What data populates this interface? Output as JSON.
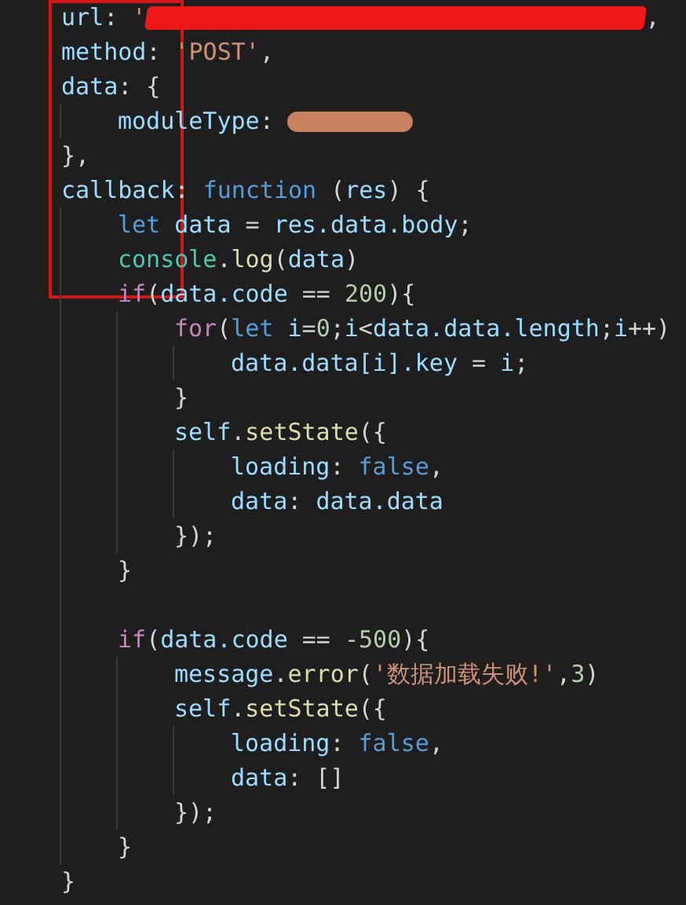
{
  "editor": {
    "lines": [
      {
        "tokens": [
          {
            "kind": "prop",
            "text": "url"
          },
          {
            "kind": "punct",
            "text": ": "
          },
          {
            "kind": "string",
            "text": "'"
          },
          {
            "kind": "scribble"
          },
          {
            "kind": "punct",
            "text": ","
          }
        ]
      },
      {
        "tokens": [
          {
            "kind": "prop",
            "text": "method"
          },
          {
            "kind": "punct",
            "text": ": "
          },
          {
            "kind": "string",
            "text": "'POST'"
          },
          {
            "kind": "punct",
            "text": ","
          }
        ]
      },
      {
        "tokens": [
          {
            "kind": "prop",
            "text": "data"
          },
          {
            "kind": "punct",
            "text": ": {"
          }
        ],
        "children": [
          {
            "tokens": [
              {
                "kind": "prop",
                "text": "moduleType"
              },
              {
                "kind": "punct",
                "text": ": "
              },
              {
                "kind": "smudge"
              }
            ]
          }
        ]
      },
      {
        "tokens": [
          {
            "kind": "punct",
            "text": "},"
          }
        ]
      },
      {
        "tokens": [
          {
            "kind": "prop",
            "text": "callback"
          },
          {
            "kind": "punct",
            "text": ": "
          },
          {
            "kind": "keyword",
            "text": "function"
          },
          {
            "kind": "punct",
            "text": " ("
          },
          {
            "kind": "prop",
            "text": "res"
          },
          {
            "kind": "punct",
            "text": ") {"
          }
        ],
        "children": [
          {
            "tokens": [
              {
                "kind": "keyword",
                "text": "let"
              },
              {
                "kind": "prop",
                "text": " data "
              },
              {
                "kind": "punct",
                "text": "= "
              },
              {
                "kind": "prop",
                "text": "res.data.body"
              },
              {
                "kind": "punct",
                "text": ";"
              }
            ]
          },
          {
            "tokens": [
              {
                "kind": "type",
                "text": "console"
              },
              {
                "kind": "punct",
                "text": "."
              },
              {
                "kind": "func",
                "text": "log"
              },
              {
                "kind": "punct",
                "text": "("
              },
              {
                "kind": "prop",
                "text": "data"
              },
              {
                "kind": "punct",
                "text": ")"
              }
            ]
          },
          {
            "tokens": [
              {
                "kind": "control",
                "text": "if"
              },
              {
                "kind": "punct",
                "text": "("
              },
              {
                "kind": "prop",
                "text": "data.code"
              },
              {
                "kind": "punct",
                "text": " == "
              },
              {
                "kind": "number",
                "text": "200"
              },
              {
                "kind": "punct",
                "text": "){"
              }
            ],
            "children": [
              {
                "tokens": [
                  {
                    "kind": "control",
                    "text": "for"
                  },
                  {
                    "kind": "punct",
                    "text": "("
                  },
                  {
                    "kind": "keyword",
                    "text": "let"
                  },
                  {
                    "kind": "prop",
                    "text": " i"
                  },
                  {
                    "kind": "punct",
                    "text": "="
                  },
                  {
                    "kind": "number",
                    "text": "0"
                  },
                  {
                    "kind": "punct",
                    "text": ";"
                  },
                  {
                    "kind": "prop",
                    "text": "i"
                  },
                  {
                    "kind": "punct",
                    "text": "<"
                  },
                  {
                    "kind": "prop",
                    "text": "data.data.length"
                  },
                  {
                    "kind": "punct",
                    "text": ";"
                  },
                  {
                    "kind": "prop",
                    "text": "i"
                  },
                  {
                    "kind": "punct",
                    "text": "++)"
                  }
                ],
                "children": [
                  {
                    "tokens": [
                      {
                        "kind": "prop",
                        "text": "data.data[i].key"
                      },
                      {
                        "kind": "punct",
                        "text": " = "
                      },
                      {
                        "kind": "prop",
                        "text": "i"
                      },
                      {
                        "kind": "punct",
                        "text": ";"
                      }
                    ]
                  }
                ]
              },
              {
                "tokens": [
                  {
                    "kind": "punct",
                    "text": "}"
                  }
                ]
              },
              {
                "tokens": [
                  {
                    "kind": "prop",
                    "text": "self"
                  },
                  {
                    "kind": "punct",
                    "text": "."
                  },
                  {
                    "kind": "func",
                    "text": "setState"
                  },
                  {
                    "kind": "punct",
                    "text": "({"
                  }
                ],
                "children": [
                  {
                    "tokens": [
                      {
                        "kind": "prop",
                        "text": "loading"
                      },
                      {
                        "kind": "punct",
                        "text": ": "
                      },
                      {
                        "kind": "keyword",
                        "text": "false"
                      },
                      {
                        "kind": "punct",
                        "text": ","
                      }
                    ]
                  },
                  {
                    "tokens": [
                      {
                        "kind": "prop",
                        "text": "data"
                      },
                      {
                        "kind": "punct",
                        "text": ": "
                      },
                      {
                        "kind": "prop",
                        "text": "data.data"
                      }
                    ]
                  }
                ]
              },
              {
                "tokens": [
                  {
                    "kind": "punct",
                    "text": "});"
                  }
                ]
              }
            ]
          },
          {
            "tokens": [
              {
                "kind": "punct",
                "text": "}"
              }
            ]
          },
          {
            "blank_line_before": true,
            "tokens": [
              {
                "kind": "control",
                "text": "if"
              },
              {
                "kind": "punct",
                "text": "("
              },
              {
                "kind": "prop",
                "text": "data.code"
              },
              {
                "kind": "punct",
                "text": " == "
              },
              {
                "kind": "number",
                "text": "-500"
              },
              {
                "kind": "punct",
                "text": "){"
              }
            ],
            "children": [
              {
                "tokens": [
                  {
                    "kind": "prop",
                    "text": "message"
                  },
                  {
                    "kind": "punct",
                    "text": "."
                  },
                  {
                    "kind": "func",
                    "text": "error"
                  },
                  {
                    "kind": "punct",
                    "text": "("
                  },
                  {
                    "kind": "string",
                    "text": "'数据加载失败!'"
                  },
                  {
                    "kind": "punct",
                    "text": ","
                  },
                  {
                    "kind": "number",
                    "text": "3"
                  },
                  {
                    "kind": "punct",
                    "text": ")"
                  }
                ]
              },
              {
                "tokens": [
                  {
                    "kind": "prop",
                    "text": "self"
                  },
                  {
                    "kind": "punct",
                    "text": "."
                  },
                  {
                    "kind": "func",
                    "text": "setState"
                  },
                  {
                    "kind": "punct",
                    "text": "({"
                  }
                ],
                "children": [
                  {
                    "tokens": [
                      {
                        "kind": "prop",
                        "text": "loading"
                      },
                      {
                        "kind": "punct",
                        "text": ": "
                      },
                      {
                        "kind": "keyword",
                        "text": "false"
                      },
                      {
                        "kind": "punct",
                        "text": ","
                      }
                    ]
                  },
                  {
                    "tokens": [
                      {
                        "kind": "prop",
                        "text": "data"
                      },
                      {
                        "kind": "punct",
                        "text": ": []"
                      }
                    ]
                  }
                ]
              },
              {
                "tokens": [
                  {
                    "kind": "punct",
                    "text": "});"
                  }
                ]
              }
            ]
          },
          {
            "tokens": [
              {
                "kind": "punct",
                "text": "}"
              }
            ]
          }
        ]
      },
      {
        "tokens": [
          {
            "kind": "punct",
            "text": "}"
          }
        ]
      }
    ]
  },
  "annotation": {
    "kind": "box"
  }
}
